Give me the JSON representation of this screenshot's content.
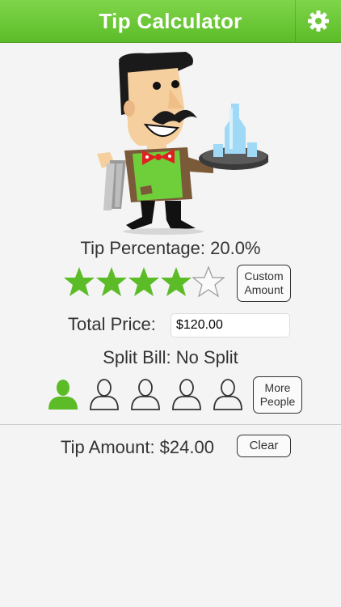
{
  "header": {
    "title": "Tip Calculator",
    "settings_icon": "gear-icon"
  },
  "tip": {
    "label": "Tip Percentage: 20.0%",
    "stars_filled": 4,
    "stars_total": 5,
    "custom_button": "Custom\nAmount"
  },
  "total": {
    "label": "Total Price:",
    "value": "$120.00"
  },
  "split": {
    "label": "Split Bill: No Split",
    "people_selected": 1,
    "people_shown": 5,
    "more_button": "More\nPeople"
  },
  "result": {
    "label": "Tip Amount: $24.00",
    "clear_button": "Clear"
  },
  "colors": {
    "accent": "#5cbc28",
    "text": "#333333"
  }
}
